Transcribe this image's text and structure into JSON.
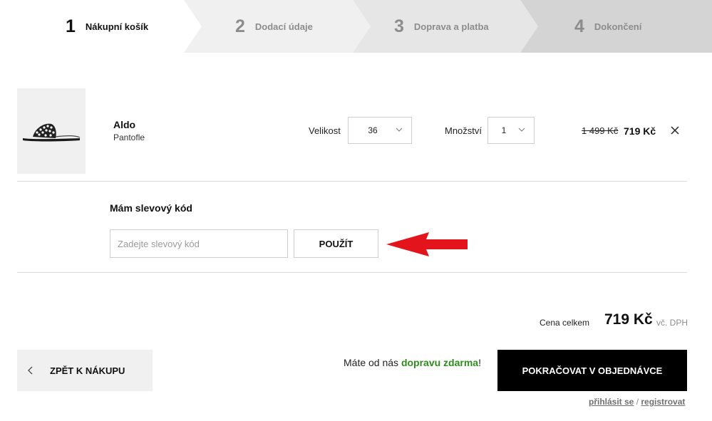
{
  "steps": [
    {
      "number": "1",
      "label": "Nákupní košík",
      "active": true
    },
    {
      "number": "2",
      "label": "Dodací údaje",
      "active": false
    },
    {
      "number": "3",
      "label": "Doprava a platba",
      "active": false
    },
    {
      "number": "4",
      "label": "Dokončení",
      "active": false
    }
  ],
  "colors": {
    "step_active_bg": "#ffffff",
    "step2_bg": "#f0f0f0",
    "step3_bg": "#e6e6e6",
    "step4_bg": "#d4d4d4",
    "accent_green": "#2e8b1e",
    "arrow_red": "#e3141b",
    "primary_button": "#000000"
  },
  "cart_item": {
    "brand": "Aldo",
    "type": "Pantofle",
    "size_label": "Velikost",
    "size_value": "36",
    "quantity_label": "Množství",
    "quantity_value": "1",
    "price_old": "1 499 Kč",
    "price_new": "719  Kč",
    "image_icon": "sandal-image"
  },
  "coupon": {
    "title": "Mám slevový kód",
    "placeholder": "Zadejte slevový kód",
    "value": "",
    "apply_label": "POUŽÍT"
  },
  "total": {
    "label": "Cena celkem",
    "value": "719 Kč",
    "vat": "vč. DPH"
  },
  "footer": {
    "back_label": "ZPĚT K NÁKUPU",
    "shipping_prefix": "Máte od nás ",
    "shipping_highlight": "dopravu zdarma",
    "shipping_suffix": "!",
    "continue_label": "POKRAČOVAT V OBJEDNÁVCE",
    "login_link": "přihlásit se",
    "separator": " / ",
    "register_link": "registrovat"
  }
}
